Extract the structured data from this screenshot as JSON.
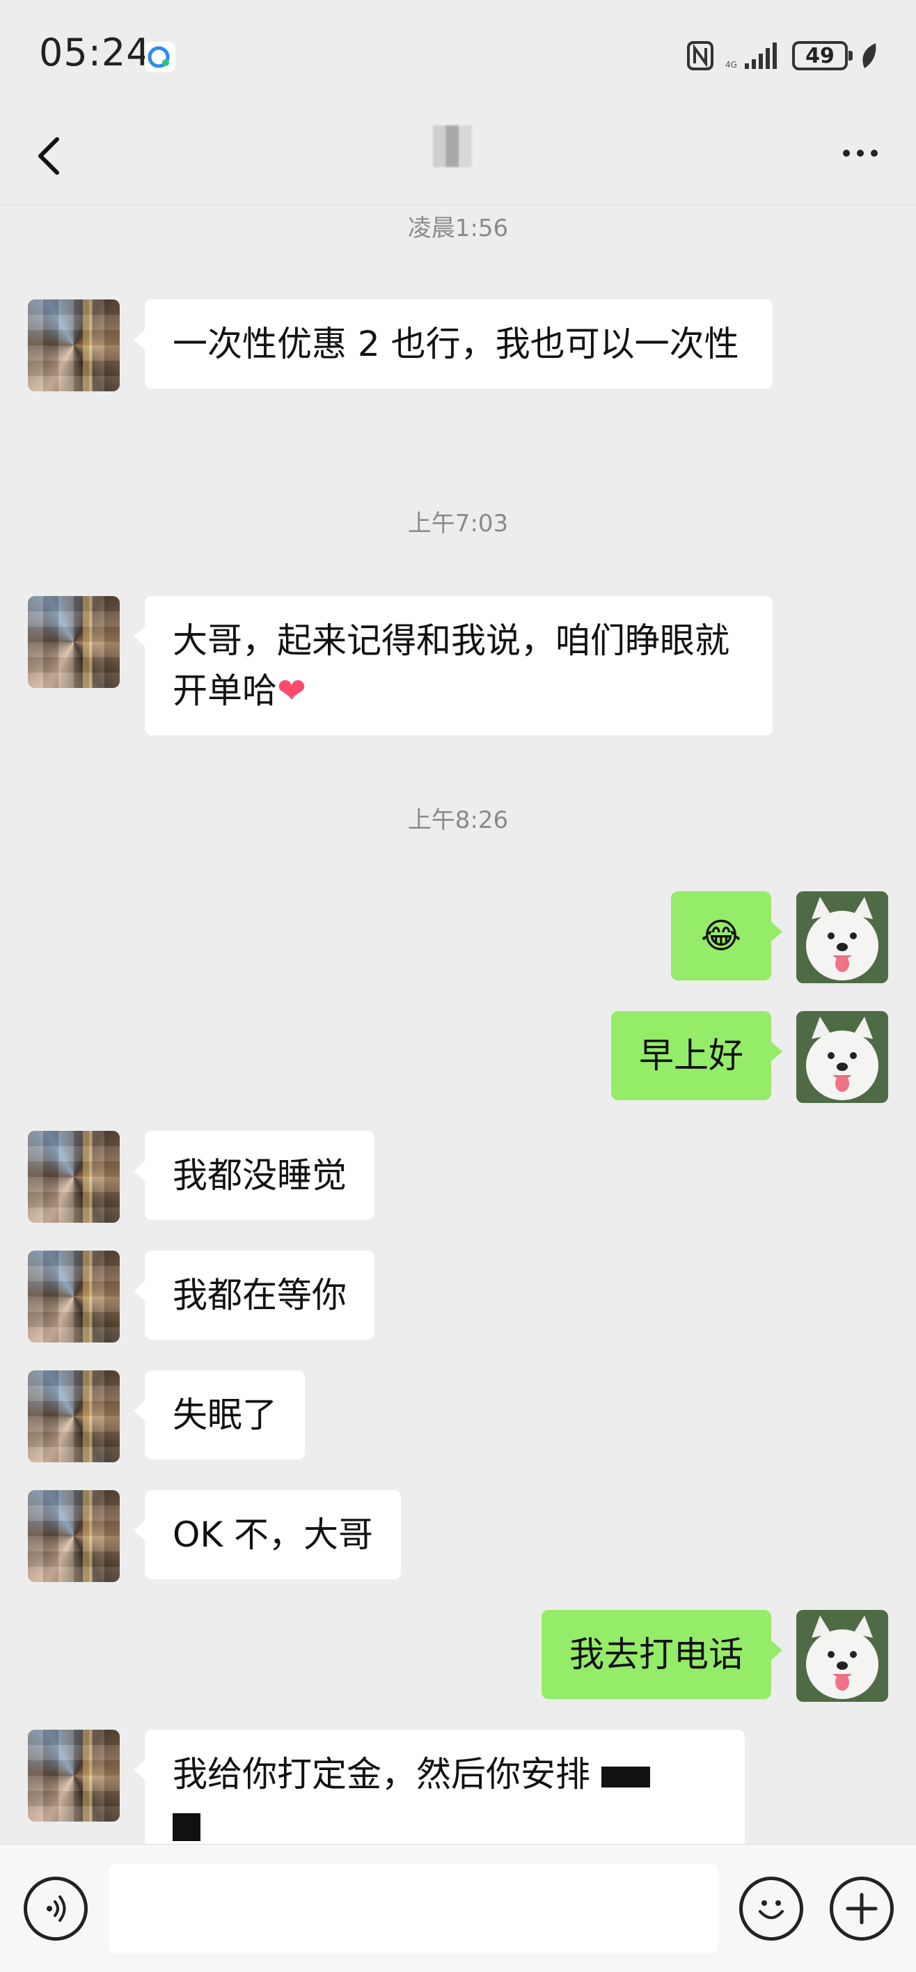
{
  "status_bar": {
    "time": "05:24",
    "battery": "49",
    "network": "4G"
  },
  "nav": {
    "title": "",
    "back_icon": "chevron-left-icon",
    "more_icon": "more-horizontal-icon"
  },
  "messages": [
    {
      "type": "timestamp",
      "text": "凌晨1:56"
    },
    {
      "type": "in",
      "text": "一次性优惠 2 也行，我也可以一次性"
    },
    {
      "type": "timestamp",
      "text": "上午7:03"
    },
    {
      "type": "in",
      "text": "大哥，起来记得和我说，咱们睁眼就开单哈"
    },
    {
      "type": "timestamp",
      "text": "上午8:26"
    },
    {
      "type": "out",
      "text": "😂"
    },
    {
      "type": "out",
      "text": "早上好"
    },
    {
      "type": "in",
      "text": "我都没睡觉"
    },
    {
      "type": "in",
      "text": "我都在等你"
    },
    {
      "type": "in",
      "text": "失眠了"
    },
    {
      "type": "in",
      "text": "OK 不，大哥"
    },
    {
      "type": "out",
      "text": "我去打电话"
    },
    {
      "type": "in",
      "text": "我给你打定金，然后你安排"
    }
  ],
  "input_bar": {
    "placeholder": "",
    "voice_icon": "voice-icon",
    "emoji_icon": "emoji-icon",
    "plus_icon": "plus-icon"
  },
  "colors": {
    "background": "#ededed",
    "incoming_bubble": "#ffffff",
    "outgoing_bubble": "#95ec69",
    "timestamp": "#8a8a8a"
  }
}
